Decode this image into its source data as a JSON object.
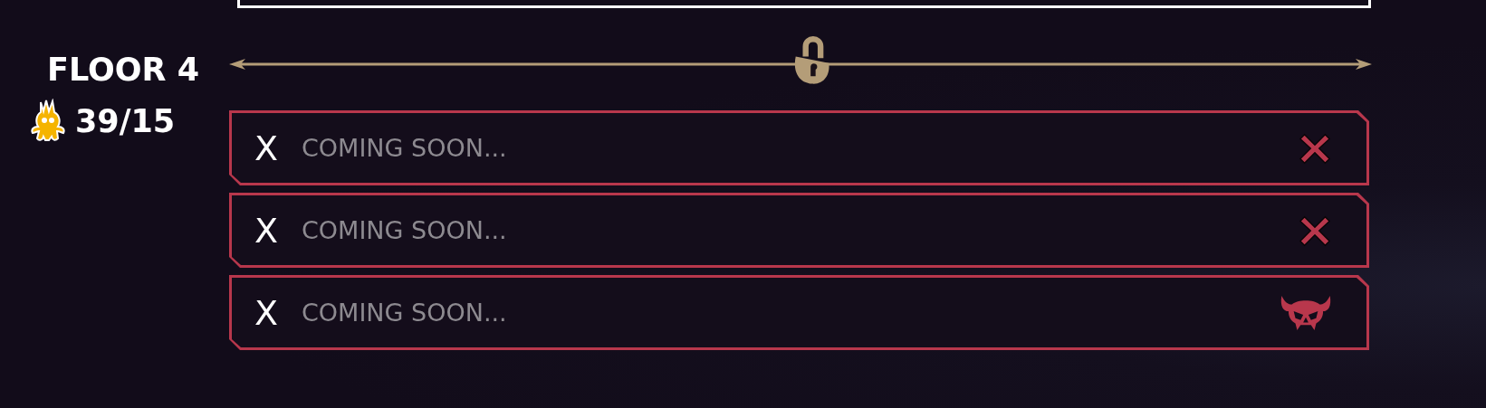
{
  "floor": {
    "label": "FLOOR 4"
  },
  "counter": {
    "value": "39/15"
  },
  "rows": [
    {
      "mark": "X",
      "text": "COMING SOON...",
      "kind": "cross"
    },
    {
      "mark": "X",
      "text": "COMING SOON...",
      "kind": "cross"
    },
    {
      "mark": "X",
      "text": "COMING SOON...",
      "kind": "skull"
    }
  ]
}
